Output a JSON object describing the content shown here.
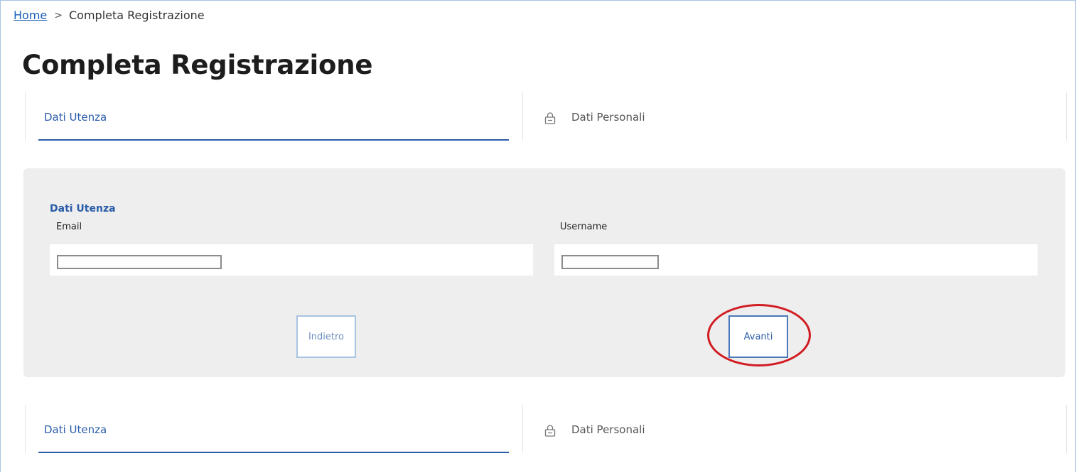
{
  "breadcrumb": {
    "home": "Home",
    "separator": ">",
    "current": "Completa Registrazione"
  },
  "page": {
    "title": "Completa Registrazione"
  },
  "steps": [
    {
      "label": "Dati Utenza",
      "active": true
    },
    {
      "label": "Dati Personali",
      "active": false,
      "icon": "lock-icon"
    }
  ],
  "form": {
    "section_title": "Dati Utenza",
    "email": {
      "label": "Email",
      "value": ""
    },
    "username": {
      "label": "Username",
      "value": ""
    },
    "back_button": "Indietro",
    "next_button": "Avanti"
  },
  "colors": {
    "accent": "#2a5ca8",
    "panel_bg": "#eeeeee",
    "highlight": "#d11c22"
  }
}
